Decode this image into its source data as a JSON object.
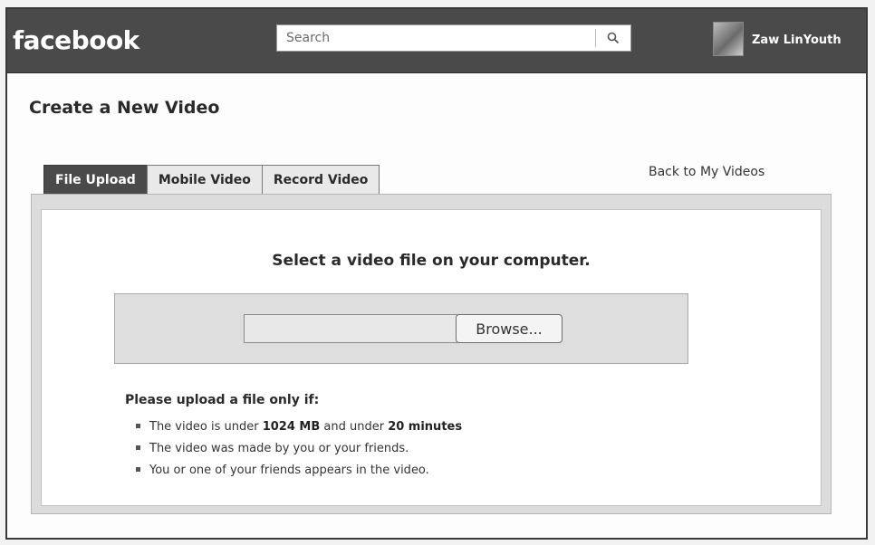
{
  "header": {
    "logo": "facebook",
    "search_placeholder": "Search",
    "search_icon": "magnifier-icon",
    "user_name": "Zaw LinYouth"
  },
  "page": {
    "title": "Create a New Video"
  },
  "tabs": [
    {
      "label": "File Upload",
      "active": true
    },
    {
      "label": "Mobile Video",
      "active": false
    },
    {
      "label": "Record Video",
      "active": false
    }
  ],
  "back_link": "Back to My Videos",
  "upload": {
    "heading": "Select a video file on your computer.",
    "file_path_value": "",
    "browse_label": "Browse..."
  },
  "rules": {
    "heading": "Please upload a file only if:",
    "items": [
      {
        "pre": "The video is under ",
        "b1": "1024 MB",
        "mid": " and under ",
        "b2": "20 minutes"
      },
      {
        "text": "The video was made by you or your friends."
      },
      {
        "text": "You or one of your friends appears in the video."
      }
    ]
  },
  "colors": {
    "header_bg": "#4a4a4a",
    "active_tab_bg": "#4a4a4a",
    "panel_bg": "#dcdcdc"
  }
}
